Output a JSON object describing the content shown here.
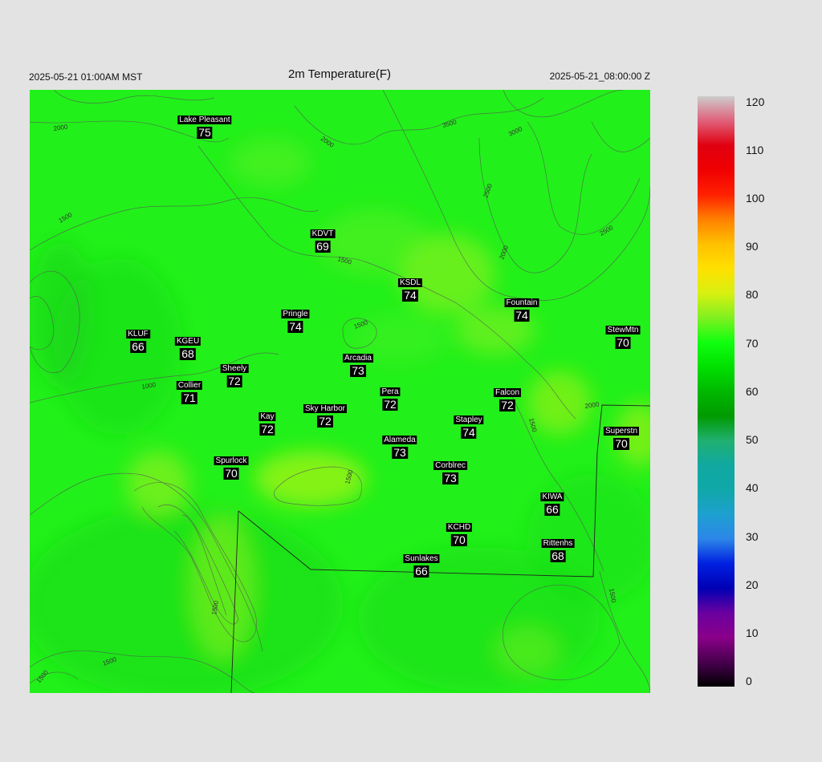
{
  "header": {
    "title": "2m Temperature(F)",
    "local_time": "2025-05-21 01:00AM MST",
    "utc_time": "2025-05-21_08:00:00 Z"
  },
  "stations": [
    {
      "name": "Lake Pleasant",
      "value": "75"
    },
    {
      "name": "KDVT",
      "value": "69"
    },
    {
      "name": "KSDL",
      "value": "74"
    },
    {
      "name": "Fountain",
      "value": "74"
    },
    {
      "name": "Pringle",
      "value": "74"
    },
    {
      "name": "StewMtn",
      "value": "70"
    },
    {
      "name": "KLUF",
      "value": "66"
    },
    {
      "name": "KGEU",
      "value": "68"
    },
    {
      "name": "Arcadia",
      "value": "73"
    },
    {
      "name": "Sheely",
      "value": "72"
    },
    {
      "name": "Collier",
      "value": "71"
    },
    {
      "name": "Pera",
      "value": "72"
    },
    {
      "name": "Falcon",
      "value": "72"
    },
    {
      "name": "Kay",
      "value": "72"
    },
    {
      "name": "Sky Harbor",
      "value": "72"
    },
    {
      "name": "Stapley",
      "value": "74"
    },
    {
      "name": "Superstn",
      "value": "70"
    },
    {
      "name": "Alameda",
      "value": "73"
    },
    {
      "name": "Spurlock",
      "value": "70"
    },
    {
      "name": "Corblrec",
      "value": "73"
    },
    {
      "name": "KIWA",
      "value": "66"
    },
    {
      "name": "KCHD",
      "value": "70"
    },
    {
      "name": "Rittenhs",
      "value": "68"
    },
    {
      "name": "Sunlakes",
      "value": "66"
    }
  ],
  "contour_labels": [
    "2000",
    "3500",
    "3000",
    "2000",
    "1500",
    "2500",
    "2500",
    "1500",
    "2000",
    "1500",
    "1000",
    "1500",
    "2000",
    "1500",
    "1500",
    "1500",
    "1500",
    "1500"
  ],
  "colorbar": {
    "ticks": [
      "120",
      "110",
      "100",
      "90",
      "80",
      "70",
      "60",
      "50",
      "40",
      "30",
      "20",
      "10",
      "0"
    ],
    "stops": [
      {
        "value": 0,
        "color": "#000000"
      },
      {
        "value": 4,
        "color": "#3a0040"
      },
      {
        "value": 10,
        "color": "#8a008a"
      },
      {
        "value": 15,
        "color": "#6a00a0"
      },
      {
        "value": 20,
        "color": "#0000b4"
      },
      {
        "value": 25,
        "color": "#0020e0"
      },
      {
        "value": 30,
        "color": "#2c86e8"
      },
      {
        "value": 35,
        "color": "#1ea0d0"
      },
      {
        "value": 40,
        "color": "#10a8a8"
      },
      {
        "value": 45,
        "color": "#10a8a0"
      },
      {
        "value": 50,
        "color": "#20b070"
      },
      {
        "value": 55,
        "color": "#009a00"
      },
      {
        "value": 60,
        "color": "#00b800"
      },
      {
        "value": 65,
        "color": "#00e000"
      },
      {
        "value": 70,
        "color": "#10ff10"
      },
      {
        "value": 75,
        "color": "#80f020"
      },
      {
        "value": 80,
        "color": "#d8f010"
      },
      {
        "value": 85,
        "color": "#ffe000"
      },
      {
        "value": 90,
        "color": "#ffc000"
      },
      {
        "value": 95,
        "color": "#ff8000"
      },
      {
        "value": 100,
        "color": "#ff2000"
      },
      {
        "value": 105,
        "color": "#f00000"
      },
      {
        "value": 110,
        "color": "#e00010"
      },
      {
        "value": 115,
        "color": "#e0607a"
      },
      {
        "value": 120,
        "color": "#cccccc"
      }
    ]
  }
}
